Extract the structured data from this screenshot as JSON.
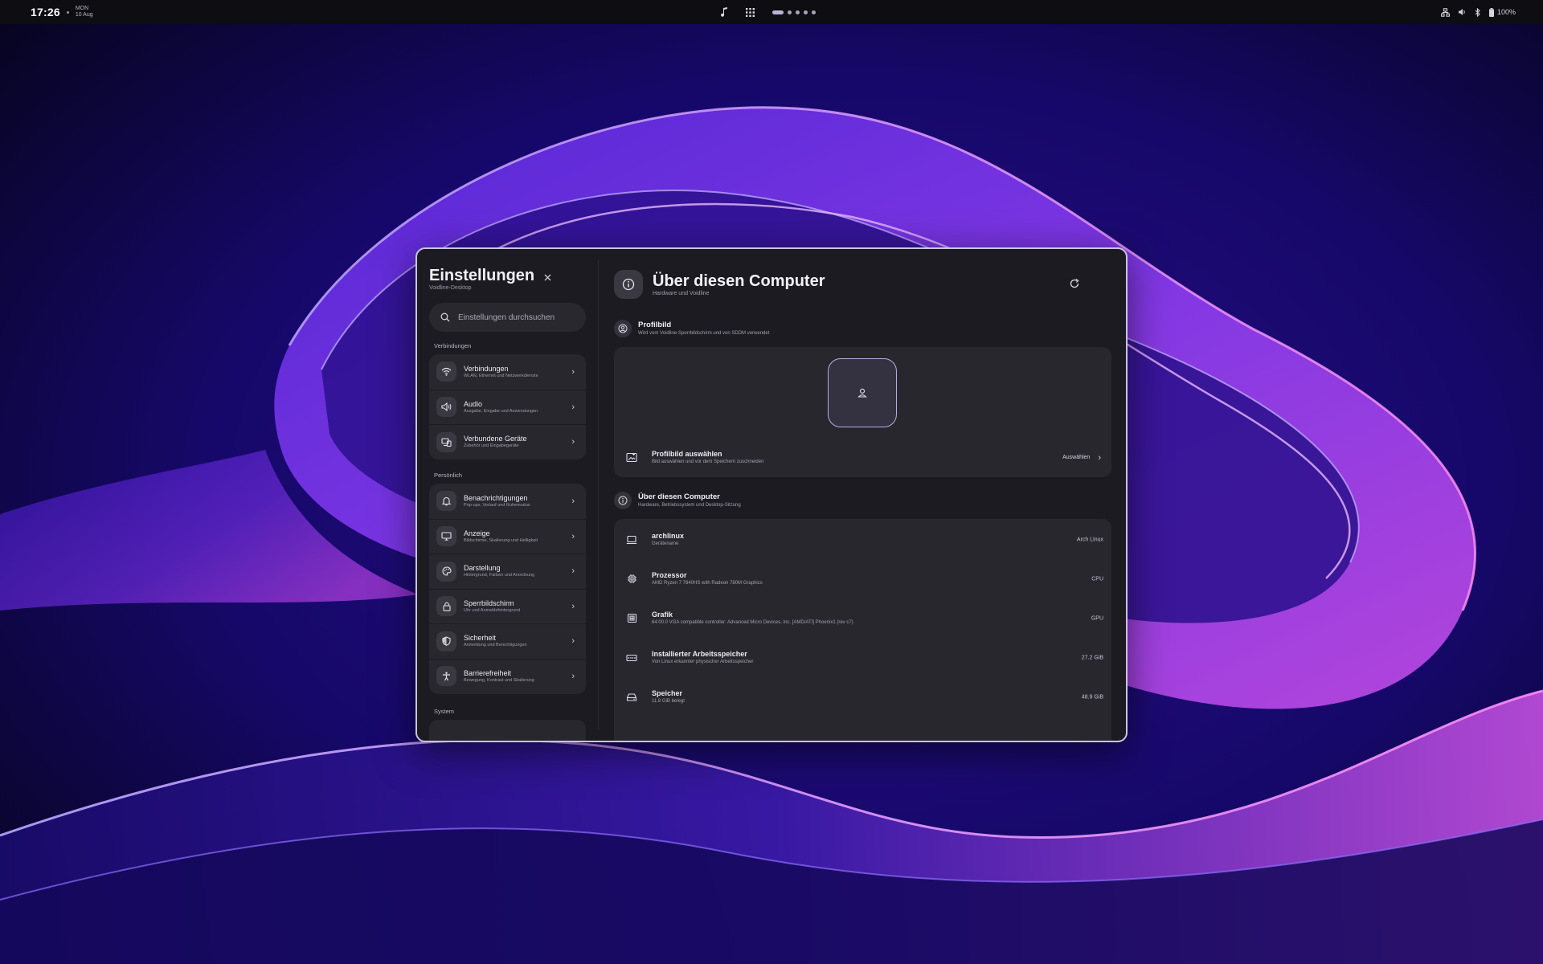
{
  "topbar": {
    "time": "17:26",
    "weekday": "MON",
    "date": "10 Aug",
    "battery": "100%",
    "workspaces": 5,
    "active_workspace": 1
  },
  "window": {
    "sidebar": {
      "title": "Einstellungen",
      "subtitle": "Voidline-Desktop",
      "search_placeholder": "Einstellungen durchsuchen",
      "sections": [
        {
          "label": "Verbindungen",
          "items": [
            {
              "label": "Verbindungen",
              "desc": "WLAN, Ethernet und Netzwerkdienste",
              "icon": "wifi-icon"
            },
            {
              "label": "Audio",
              "desc": "Ausgabe, Eingabe und Anwendungen",
              "icon": "speaker-icon"
            },
            {
              "label": "Verbundene Geräte",
              "desc": "Zubehör und Eingabegeräte",
              "icon": "devices-icon"
            }
          ]
        },
        {
          "label": "Persönlich",
          "items": [
            {
              "label": "Benachrichtigungen",
              "desc": "Pop-ups, Verlauf und Ruhemodus",
              "icon": "bell-icon"
            },
            {
              "label": "Anzeige",
              "desc": "Bildschirme, Skalierung und Helligkeit",
              "icon": "monitor-icon"
            },
            {
              "label": "Darstellung",
              "desc": "Hintergrund, Farben und Anordnung",
              "icon": "palette-icon"
            },
            {
              "label": "Sperrbildschirm",
              "desc": "Uhr und Anmeldehintergrund",
              "icon": "lock-icon"
            },
            {
              "label": "Sicherheit",
              "desc": "Anmeldung und Berechtigungen",
              "icon": "shield-icon"
            },
            {
              "label": "Barrierefreiheit",
              "desc": "Bewegung, Kontrast und Skalierung",
              "icon": "accessibility-icon"
            }
          ]
        },
        {
          "label": "System",
          "items": []
        }
      ]
    },
    "main": {
      "title": "Über diesen Computer",
      "subtitle": "Hardware und Voidline",
      "profile": {
        "title": "Profilbild",
        "desc": "Wird vom Voidline-Sperrbildschirm und von SDDM verwendet",
        "select_title": "Profilbild auswählen",
        "select_desc": "Bild auswählen und vor dem Speichern zuschneiden",
        "select_action": "Auswählen"
      },
      "about": {
        "title": "Über diesen Computer",
        "desc": "Hardware, Betriebssystem und Desktop-Sitzung",
        "rows": [
          {
            "title": "archlinux",
            "desc": "Gerätename",
            "value": "Arch Linux",
            "icon": "laptop-icon"
          },
          {
            "title": "Prozessor",
            "desc": "AMD Ryzen 7 7840HS with Radeon 780M Graphics",
            "value": "CPU",
            "icon": "cpu-icon"
          },
          {
            "title": "Grafik",
            "desc": "64:00.0 VGA compatible controller: Advanced Micro Devices, Inc. [AMD/ATI] Phoenix1 (rev c7)",
            "value": "GPU",
            "icon": "gpu-icon"
          },
          {
            "title": "Installierter Arbeitsspeicher",
            "desc": "Von Linux erkannter physischer Arbeitsspeicher",
            "value": "27.2 GiB",
            "icon": "memory-icon"
          },
          {
            "title": "Speicher",
            "desc": "11.8 GiB belegt",
            "value": "48.9 GiB",
            "icon": "storage-icon"
          }
        ]
      }
    }
  }
}
